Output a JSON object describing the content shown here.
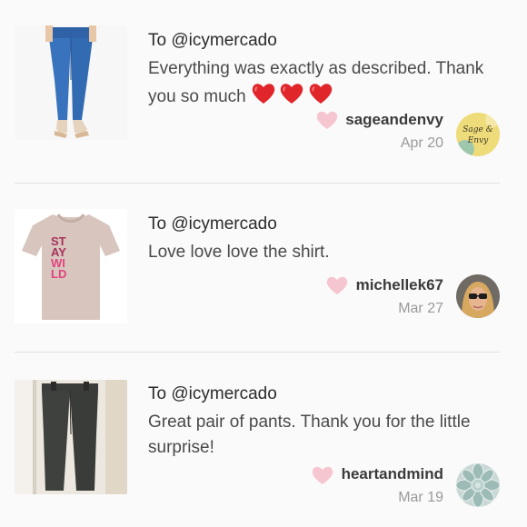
{
  "reviews": [
    {
      "to_prefix": "To",
      "to_handle": "@icymercado",
      "message": "Everything was exactly as described. Thank you so much",
      "username": "sageandenvy",
      "date": "Apr 20",
      "avatar_text": "Sage & Envy",
      "item_icon": "jeans-photo"
    },
    {
      "to_prefix": "To",
      "to_handle": "@icymercado",
      "message": "Love love love the shirt.",
      "username": "michellek67",
      "date": "Mar 27",
      "item_icon": "tshirt-photo",
      "shirt_print": [
        "ST",
        "AY",
        "WI",
        "LD"
      ]
    },
    {
      "to_prefix": "To",
      "to_handle": "@icymercado",
      "message": "Great pair of pants. Thank you for the little surprise!",
      "username": "heartandmind",
      "date": "Mar 19",
      "item_icon": "pants-photo"
    }
  ],
  "colors": {
    "like_heart": "#f6c6d0",
    "emoji_heart": "#e0262b",
    "divider": "#e2e0e2"
  }
}
